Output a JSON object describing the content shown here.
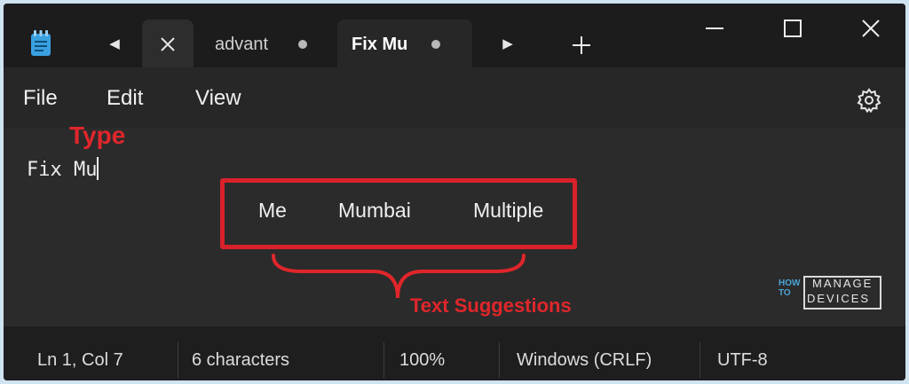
{
  "tabs": [
    {
      "label": "advant",
      "state": "unsaved"
    },
    {
      "label": "Fix Mu",
      "state": "unsaved",
      "active": true
    }
  ],
  "tabbar": {
    "icons": [
      "notepad-icon",
      "scroll-left-icon",
      "close-icon",
      "scroll-right-icon",
      "plus-icon"
    ]
  },
  "window_controls": [
    "minimize-icon",
    "maximize-icon",
    "close-icon"
  ],
  "menu": {
    "file": "File",
    "edit": "Edit",
    "view": "View",
    "settings_icon": "gear-icon"
  },
  "editor": {
    "text": "Fix Mu"
  },
  "suggestions": [
    "Me",
    "Mumbai",
    "Multiple"
  ],
  "annotations": {
    "type_label": "Type",
    "suggestions_label": "Text Suggestions",
    "color": "#e0262b"
  },
  "watermark": {
    "how": "HOW",
    "to": "TO",
    "manage": "MANAGE",
    "devices": "DEVICES"
  },
  "status": {
    "position": "Ln 1, Col 7",
    "characters": "6 characters",
    "zoom": "100%",
    "line_ending": "Windows (CRLF)",
    "encoding": "UTF-8"
  }
}
